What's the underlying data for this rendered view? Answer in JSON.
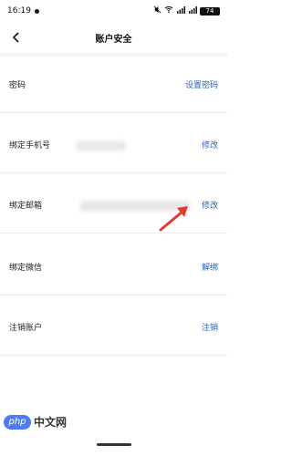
{
  "status_bar": {
    "time": "16:19",
    "battery": "74"
  },
  "header": {
    "title": "账户安全"
  },
  "rows": [
    {
      "label": "密码",
      "action": "设置密码"
    },
    {
      "label": "绑定手机号",
      "action": "修改"
    },
    {
      "label": "绑定邮箱",
      "action": "修改"
    },
    {
      "label": "绑定微信",
      "action": "解绑"
    },
    {
      "label": "注销账户",
      "action": "注销"
    }
  ],
  "watermark": {
    "logo": "php",
    "text": "中文网"
  },
  "colors": {
    "link": "#2a62b8",
    "arrow": "#e23b2e",
    "background": "#ffffff",
    "divider": "#ececec"
  }
}
